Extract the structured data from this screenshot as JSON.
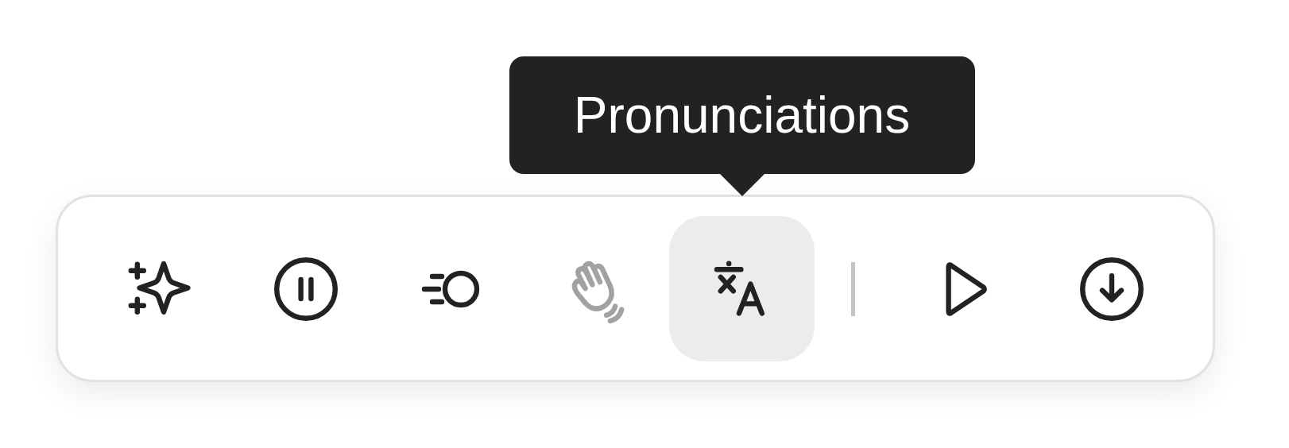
{
  "tooltip": {
    "text": "Pronunciations"
  },
  "toolbar": {
    "groups": [
      [
        {
          "kind": "sparkle",
          "selected": false,
          "disabled": false
        },
        {
          "kind": "pause",
          "selected": false,
          "disabled": false
        },
        {
          "kind": "speed",
          "selected": false,
          "disabled": false
        },
        {
          "kind": "wave",
          "selected": false,
          "disabled": true
        },
        {
          "kind": "translate",
          "selected": true,
          "disabled": false
        }
      ],
      [
        {
          "kind": "play",
          "selected": false,
          "disabled": false
        },
        {
          "kind": "download",
          "selected": false,
          "disabled": false
        }
      ]
    ]
  }
}
